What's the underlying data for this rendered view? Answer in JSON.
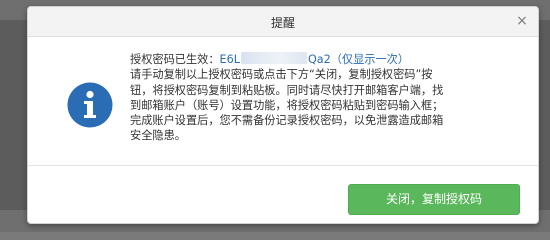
{
  "dialog": {
    "title": "提醒",
    "close_label": "×",
    "message": {
      "code_prefix": "授权密码已生效：",
      "code_start": "E6L",
      "code_end": "Qa2",
      "code_note": "（仅显示一次）",
      "lines": [
        "请手动复制以上授权密码或点击下方“关闭，复制授权密码”按",
        "钮，将授权密码复制到粘贴板。同时请尽快打开邮箱客户端，找",
        "到邮箱账户（账号）设置功能，将授权密码粘贴到密码输入框；",
        "完成账户设置后，您不需备份记录授权密码，以免泄露造成邮箱",
        "安全隐患。"
      ]
    },
    "primary_button": "关闭，复制授权码",
    "icon": "info-icon"
  },
  "colors": {
    "accent_button": "#5bb75b",
    "info_icon": "#2a6db5",
    "code_text": "#2a6db5"
  }
}
